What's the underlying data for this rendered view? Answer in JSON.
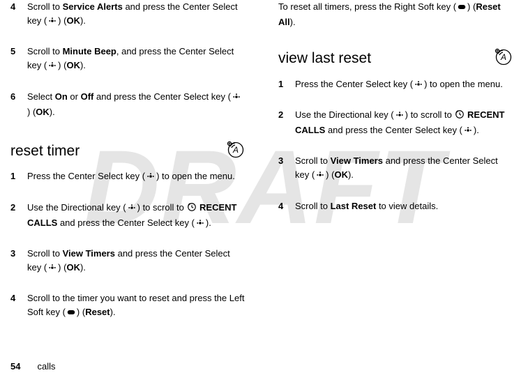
{
  "watermark": "DRAFT",
  "footer": {
    "page": "54",
    "section": "calls"
  },
  "ui": {
    "ok": "OK",
    "reset": "Reset",
    "reset_all": "Reset All"
  },
  "menu": {
    "service_alerts": "Service Alerts",
    "minute_beep": "Minute Beep",
    "on": "On",
    "off": "Off",
    "recent_calls": "RECENT CALLS",
    "view_timers": "View Timers",
    "last_reset": "Last Reset"
  },
  "left": {
    "s4_a": "Scroll to ",
    "s4_b": " and press the Center Select key (",
    "s4_c": ") (",
    "s4_d": ").",
    "s5_num": "5",
    "s5_a": "Scroll to ",
    "s5_b": ", and press the Center Select key (",
    "s5_c": ") (",
    "s5_d": ").",
    "s6_num": "6",
    "s6_a": "Select ",
    "s6_b": " or ",
    "s6_c": " and press the Center Select key (",
    "s6_d": ") (",
    "s6_e": ").",
    "h_reset_timer": "reset timer",
    "r1_num": "1",
    "r1_a": "Press the Center Select key (",
    "r1_b": ") to open the menu.",
    "r2_num": "2",
    "r2_a": "Use the Directional key (",
    "r2_b": ") to scroll to ",
    "r2_c": " and press the Center Select key (",
    "r2_d": ").",
    "r3_num": "3",
    "r3_a": "Scroll to ",
    "r3_b": " and press the Center Select key (",
    "r3_c": ") (",
    "r3_d": ").",
    "r4_num": "4",
    "r4_a": "Scroll to the timer you want to reset and press the Left Soft key (",
    "r4_b": ") (",
    "r4_c": ")."
  },
  "right": {
    "top_a": "To reset all timers, press the Right Soft key (",
    "top_b": ") (",
    "top_c": ").",
    "h_view_last_reset": "view last reset",
    "v1_num": "1",
    "v1_a": "Press the Center Select key (",
    "v1_b": ") to open the menu.",
    "v2_num": "2",
    "v2_a": "Use the Directional key (",
    "v2_b": ") to scroll to ",
    "v2_c": " and press the Center Select key (",
    "v2_d": ").",
    "v3_num": "3",
    "v3_a": "Scroll to ",
    "v3_b": " and press the Center Select key (",
    "v3_c": ") (",
    "v3_d": ").",
    "v4_num": "4",
    "v4_a": "Scroll to ",
    "v4_b": " to view details."
  },
  "num4": "4"
}
